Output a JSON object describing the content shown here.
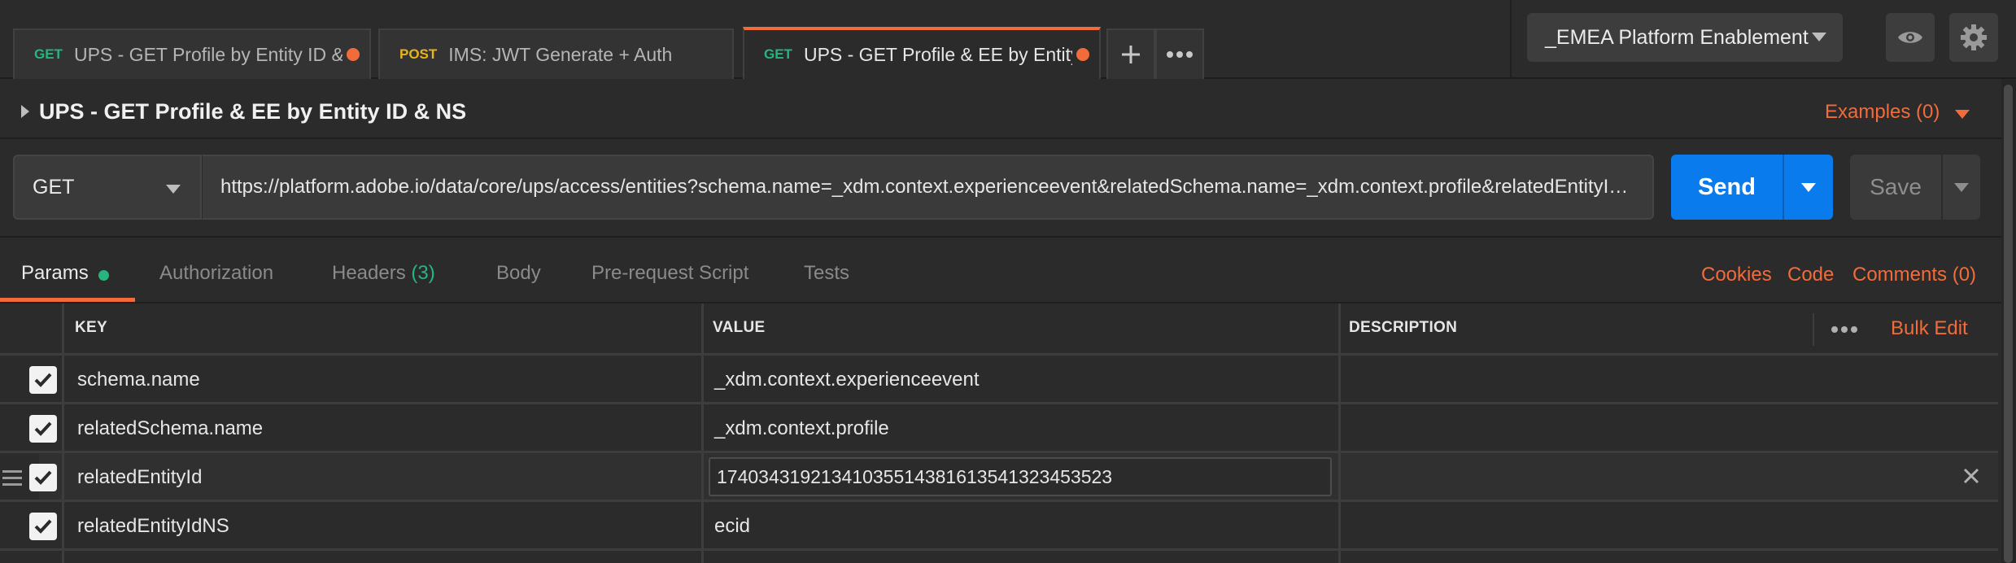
{
  "tabs": [
    {
      "method": "GET",
      "label": "UPS - GET Profile by Entity ID & N",
      "unsaved": true,
      "active": false
    },
    {
      "method": "POST",
      "label": "IMS: JWT Generate + Auth",
      "unsaved": false,
      "active": false
    },
    {
      "method": "GET",
      "label": "UPS - GET Profile & EE by Entity I",
      "unsaved": true,
      "active": true
    }
  ],
  "tab_actions": {
    "add_icon": "plus-icon",
    "more_icon": "more-horizontal-icon"
  },
  "environment": {
    "selected": "_EMEA Platform Enablement"
  },
  "header_icons": {
    "eye": "eye-icon",
    "settings": "gear-icon"
  },
  "request": {
    "name": "UPS - GET Profile & EE by Entity ID & NS",
    "examples_label": "Examples (0)",
    "method": "GET",
    "url": "https://platform.adobe.io/data/core/ups/access/entities?schema.name=_xdm.context.experienceevent&relatedSchema.name=_xdm.context.profile&relatedEntityId=17403431921341035514381613541323453523&relatedEntityIdNS=ecid",
    "send_label": "Send",
    "save_label": "Save"
  },
  "subtabs": {
    "params": "Params",
    "authorization": "Authorization",
    "headers": "Headers",
    "headers_count": "(3)",
    "body": "Body",
    "prerequest": "Pre-request Script",
    "tests": "Tests",
    "cookies": "Cookies",
    "code": "Code",
    "comments": "Comments (0)"
  },
  "params_table": {
    "columns": {
      "key": "KEY",
      "value": "VALUE",
      "description": "DESCRIPTION"
    },
    "bulk_edit": "Bulk Edit",
    "rows": [
      {
        "key": "schema.name",
        "value": "_xdm.context.experienceevent",
        "description": "",
        "checked": true
      },
      {
        "key": "relatedSchema.name",
        "value": "_xdm.context.profile",
        "description": "",
        "checked": true
      },
      {
        "key": "relatedEntityId",
        "value": "17403431921341035514381613541323453523",
        "description": "",
        "checked": true
      },
      {
        "key": "relatedEntityIdNS",
        "value": "ecid",
        "description": "",
        "checked": true
      }
    ]
  },
  "colors": {
    "accent": "#f26b3a",
    "send": "#097bed",
    "get": "#26b47f",
    "post": "#e9b31a"
  }
}
